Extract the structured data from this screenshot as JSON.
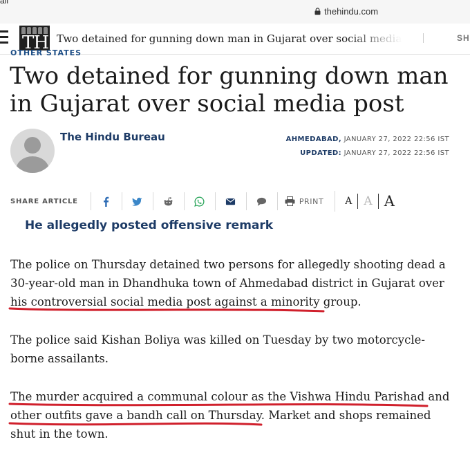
{
  "status_bar": {
    "carrier": "all"
  },
  "browser": {
    "url": "thehindu.com"
  },
  "nav": {
    "logo_text": "TH",
    "title": "Two detained for gunning down man in Gujarat over social media post",
    "share_label": "SHA"
  },
  "article": {
    "section": "OTHER STATES",
    "headline": "Two detained for gunning down man in Gujarat over social media post",
    "author": "The Hindu Bureau",
    "location": "AHMEDABAD,",
    "date": "JANUARY 27, 2022 22:56 IST",
    "updated_label": "UPDATED:",
    "updated_date": "JANUARY 27, 2022 22:56 IST",
    "subheading": "He allegedly posted offensive remark",
    "p1": "The police on Thursday detained two persons for allegedly shooting dead a 30-year-old man in Dhandhuka town of Ahmedabad district in Gujarat over his controversial social media post against a minority group.",
    "p2": "The police said Kishan Boliya was killed on Tuesday by two motorcycle-borne assailants.",
    "p3": "The murder acquired a communal colour as the Vishwa Hindu Parishad and other outfits gave a bandh call on Thursday. Market and shops remained shut in the town."
  },
  "share_bar": {
    "label": "SHARE ARTICLE",
    "icons": [
      "facebook-icon",
      "twitter-icon",
      "reddit-icon",
      "whatsapp-icon",
      "email-icon",
      "comment-icon",
      "print-icon"
    ],
    "print_label": "PRINT",
    "font_small": "A",
    "font_medium": "A",
    "font_large": "A"
  },
  "colors": {
    "brand_blue": "#1d3b66",
    "annotation_red": "#d0202c",
    "icon_blue": "#2f6db5"
  }
}
